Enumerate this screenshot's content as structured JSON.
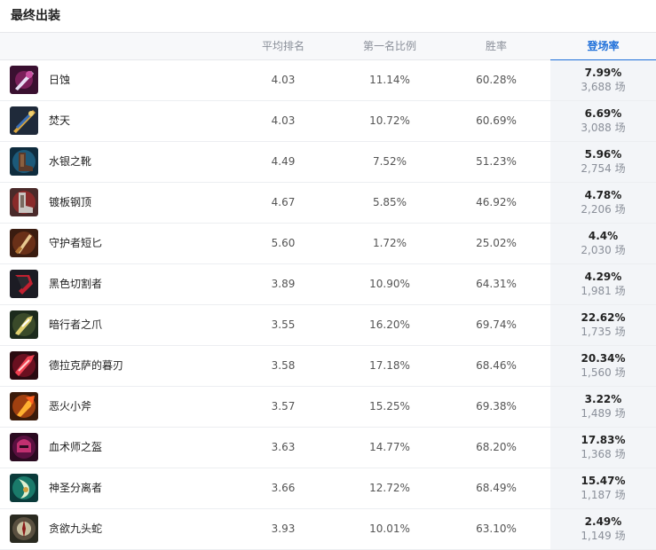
{
  "title": "最终出装",
  "headers": {
    "avg_rank": "平均排名",
    "first_rate": "第一名比例",
    "win_rate": "胜率",
    "play_rate": "登场率"
  },
  "rows": [
    {
      "name": "日蚀",
      "avg": "4.03",
      "first": "11.14%",
      "win": "60.28%",
      "play": "7.99%",
      "count": "3,688 场",
      "icon": "eclipse-icon"
    },
    {
      "name": "焚天",
      "avg": "4.03",
      "first": "10.72%",
      "win": "60.69%",
      "play": "6.69%",
      "count": "3,088 场",
      "icon": "burning-sky-icon"
    },
    {
      "name": "水银之靴",
      "avg": "4.49",
      "first": "7.52%",
      "win": "51.23%",
      "play": "5.96%",
      "count": "2,754 场",
      "icon": "mercury-boots-icon"
    },
    {
      "name": "镀板钢顶",
      "avg": "4.67",
      "first": "5.85%",
      "win": "46.92%",
      "play": "4.78%",
      "count": "2,206 场",
      "icon": "plated-steelcaps-icon"
    },
    {
      "name": "守护者短匕",
      "avg": "5.60",
      "first": "1.72%",
      "win": "25.02%",
      "play": "4.4%",
      "count": "2,030 场",
      "icon": "guardian-dagger-icon"
    },
    {
      "name": "黑色切割者",
      "avg": "3.89",
      "first": "10.90%",
      "win": "64.31%",
      "play": "4.29%",
      "count": "1,981 场",
      "icon": "black-cleaver-icon"
    },
    {
      "name": "暗行者之爪",
      "avg": "3.55",
      "first": "16.20%",
      "win": "69.74%",
      "play": "22.62%",
      "count": "1,735 场",
      "icon": "prowlers-claw-icon"
    },
    {
      "name": "德拉克萨的暮刃",
      "avg": "3.58",
      "first": "17.18%",
      "win": "68.46%",
      "play": "20.34%",
      "count": "1,560 场",
      "icon": "duskblade-icon"
    },
    {
      "name": "恶火小斧",
      "avg": "3.57",
      "first": "15.25%",
      "win": "69.38%",
      "play": "3.22%",
      "count": "1,489 场",
      "icon": "hellfire-hatchet-icon"
    },
    {
      "name": "血术师之盔",
      "avg": "3.63",
      "first": "14.77%",
      "win": "68.20%",
      "play": "17.83%",
      "count": "1,368 场",
      "icon": "bloodmage-helm-icon"
    },
    {
      "name": "神圣分离者",
      "avg": "3.66",
      "first": "12.72%",
      "win": "68.49%",
      "play": "15.47%",
      "count": "1,187 场",
      "icon": "divine-sunderer-icon"
    },
    {
      "name": "贪欲九头蛇",
      "avg": "3.93",
      "first": "10.01%",
      "win": "63.10%",
      "play": "2.49%",
      "count": "1,149 场",
      "icon": "ravenous-hydra-icon"
    }
  ],
  "colors": {
    "accent": "#1e6fd9",
    "highlight_bg": "#f3f5f8"
  }
}
